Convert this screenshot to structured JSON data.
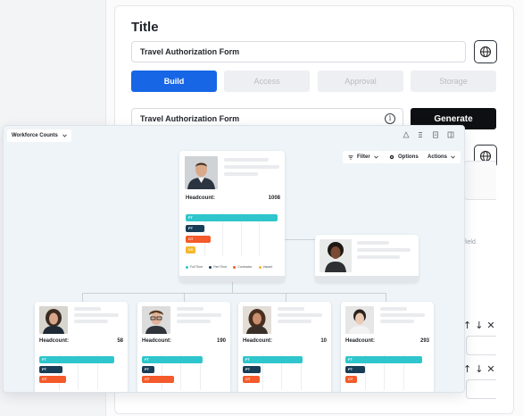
{
  "form": {
    "title_label": "Title",
    "title_value": "Travel Authorization Form",
    "tabs": [
      {
        "label": "Build",
        "active": true
      },
      {
        "label": "Access",
        "active": false
      },
      {
        "label": "Approval",
        "active": false
      },
      {
        "label": "Storage",
        "active": false
      }
    ],
    "prompt_value": "Travel Authorization Form",
    "info_icon": "i",
    "generate_label": "Generate",
    "hint_text": "field.",
    "row_controls": "↑↓✕"
  },
  "org": {
    "selector_label": "Workforce Counts",
    "toolbar": {
      "filter_label": "Filter",
      "options_label": "Options",
      "actions_label": "Actions"
    },
    "legend": [
      "Full Time",
      "Part Time",
      "Contractor",
      "Vacant"
    ],
    "colors": {
      "full_time": "#2ec6cc",
      "part_time": "#173d57",
      "contractor": "#f45a2a",
      "vacant": "#f5b82e",
      "accent_blue": "#1766e5"
    },
    "root": {
      "headcount_label": "Headcount:",
      "headcount_value": "1008",
      "bars": [
        {
          "code": "FT",
          "fraction": 1.0
        },
        {
          "code": "PT",
          "fraction": 0.2
        },
        {
          "code": "CT",
          "fraction": 0.27
        },
        {
          "code": "VC",
          "fraction": 0.11
        }
      ]
    },
    "side": {},
    "children": [
      {
        "headcount_label": "Headcount:",
        "headcount_value": "58",
        "ft": 0.98,
        "pt": 0.3,
        "ct": 0.35
      },
      {
        "headcount_label": "Headcount:",
        "headcount_value": "190",
        "ft": 0.79,
        "pt": 0.16,
        "ct": 0.42
      },
      {
        "headcount_label": "Headcount:",
        "headcount_value": "10",
        "ft": 0.78,
        "pt": 0.23,
        "ct": 0.22
      },
      {
        "headcount_label": "Headcount:",
        "headcount_value": "293",
        "ft": 1.0,
        "pt": 0.25,
        "ct": 0.15
      }
    ]
  }
}
